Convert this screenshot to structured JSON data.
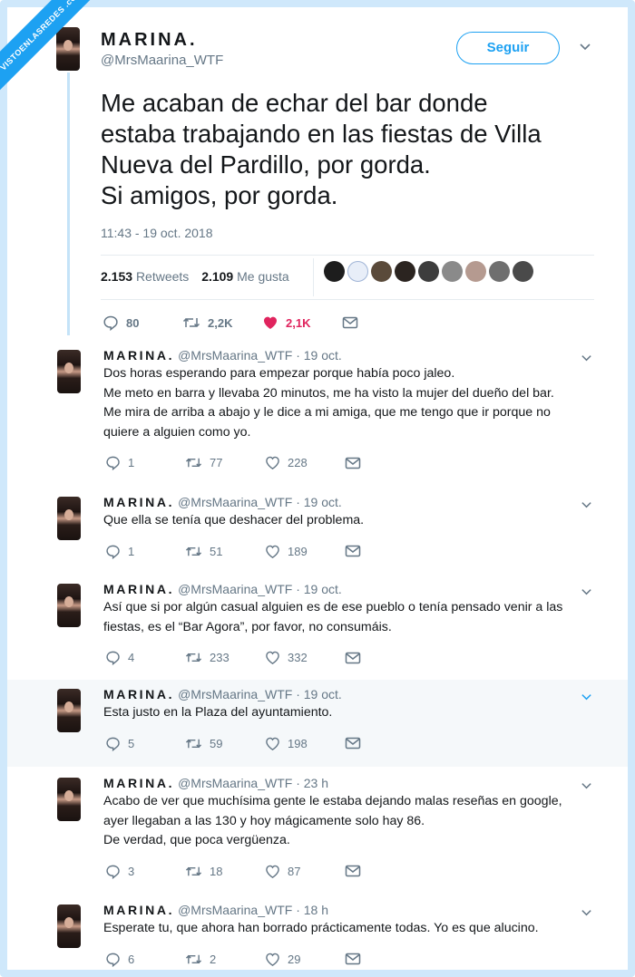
{
  "watermark": "VISTOENLASREDES .com",
  "colors": {
    "accent": "#1da1f2",
    "like": "#e0245e",
    "muted": "#657786",
    "thread": "#c4e3f8"
  },
  "main": {
    "name": "MARINA.",
    "handle": "@MrsMaarina_WTF",
    "follow_label": "Seguir",
    "text_lines": [
      "Me acaban de echar del bar donde",
      "estaba trabajando en las fiestas de Villa",
      "Nueva del Pardillo, por gorda.",
      "Si amigos, por gorda."
    ],
    "time": "11:43 - 19 oct. 2018",
    "retweets_count": "2.153",
    "retweets_label": "Retweets",
    "likes_count": "2.109",
    "likes_label": "Me gusta",
    "actions": {
      "replies": "80",
      "retweets": "2,2K",
      "likes": "2,1K"
    }
  },
  "replies": [
    {
      "name": "MARINA.",
      "meta": "@MrsMaarina_WTF · 19 oct.",
      "lines": [
        "Dos horas esperando para empezar porque había poco jaleo.",
        "Me meto en barra y llevaba 20 minutos, me ha visto la mujer del dueño del bar.",
        "Me mira de arriba a abajo y le dice a mi amiga, que me tengo que ir porque no",
        "quiere a alguien como yo."
      ],
      "replies": "1",
      "retweets": "77",
      "likes": "228"
    },
    {
      "name": "MARINA.",
      "meta": "@MrsMaarina_WTF · 19 oct.",
      "lines": [
        "Que ella se tenía que deshacer del problema."
      ],
      "replies": "1",
      "retweets": "51",
      "likes": "189"
    },
    {
      "name": "MARINA.",
      "meta": "@MrsMaarina_WTF · 19 oct.",
      "lines": [
        "Así que si por algún casual alguien es de ese pueblo o tenía pensado venir a las",
        "fiestas, es el “Bar Agora”, por favor, no consumáis."
      ],
      "replies": "4",
      "retweets": "233",
      "likes": "332"
    },
    {
      "name": "MARINA.",
      "meta": "@MrsMaarina_WTF · 19 oct.",
      "lines": [
        "Esta justo en la Plaza del ayuntamiento."
      ],
      "replies": "5",
      "retweets": "59",
      "likes": "198"
    },
    {
      "name": "MARINA.",
      "meta": "@MrsMaarina_WTF · 23 h",
      "lines": [
        "Acabo de ver que muchísima gente le estaba dejando malas reseñas en google,",
        "ayer llegaban a las 130 y hoy mágicamente solo hay 86.",
        "De verdad, que poca vergüenza."
      ],
      "replies": "3",
      "retweets": "18",
      "likes": "87"
    },
    {
      "name": "MARINA.",
      "meta": "@MrsMaarina_WTF · 18 h",
      "lines": [
        "Esperate tu, que ahora han borrado prácticamente todas. Yo es que alucino."
      ],
      "replies": "6",
      "retweets": "2",
      "likes": "29"
    }
  ]
}
